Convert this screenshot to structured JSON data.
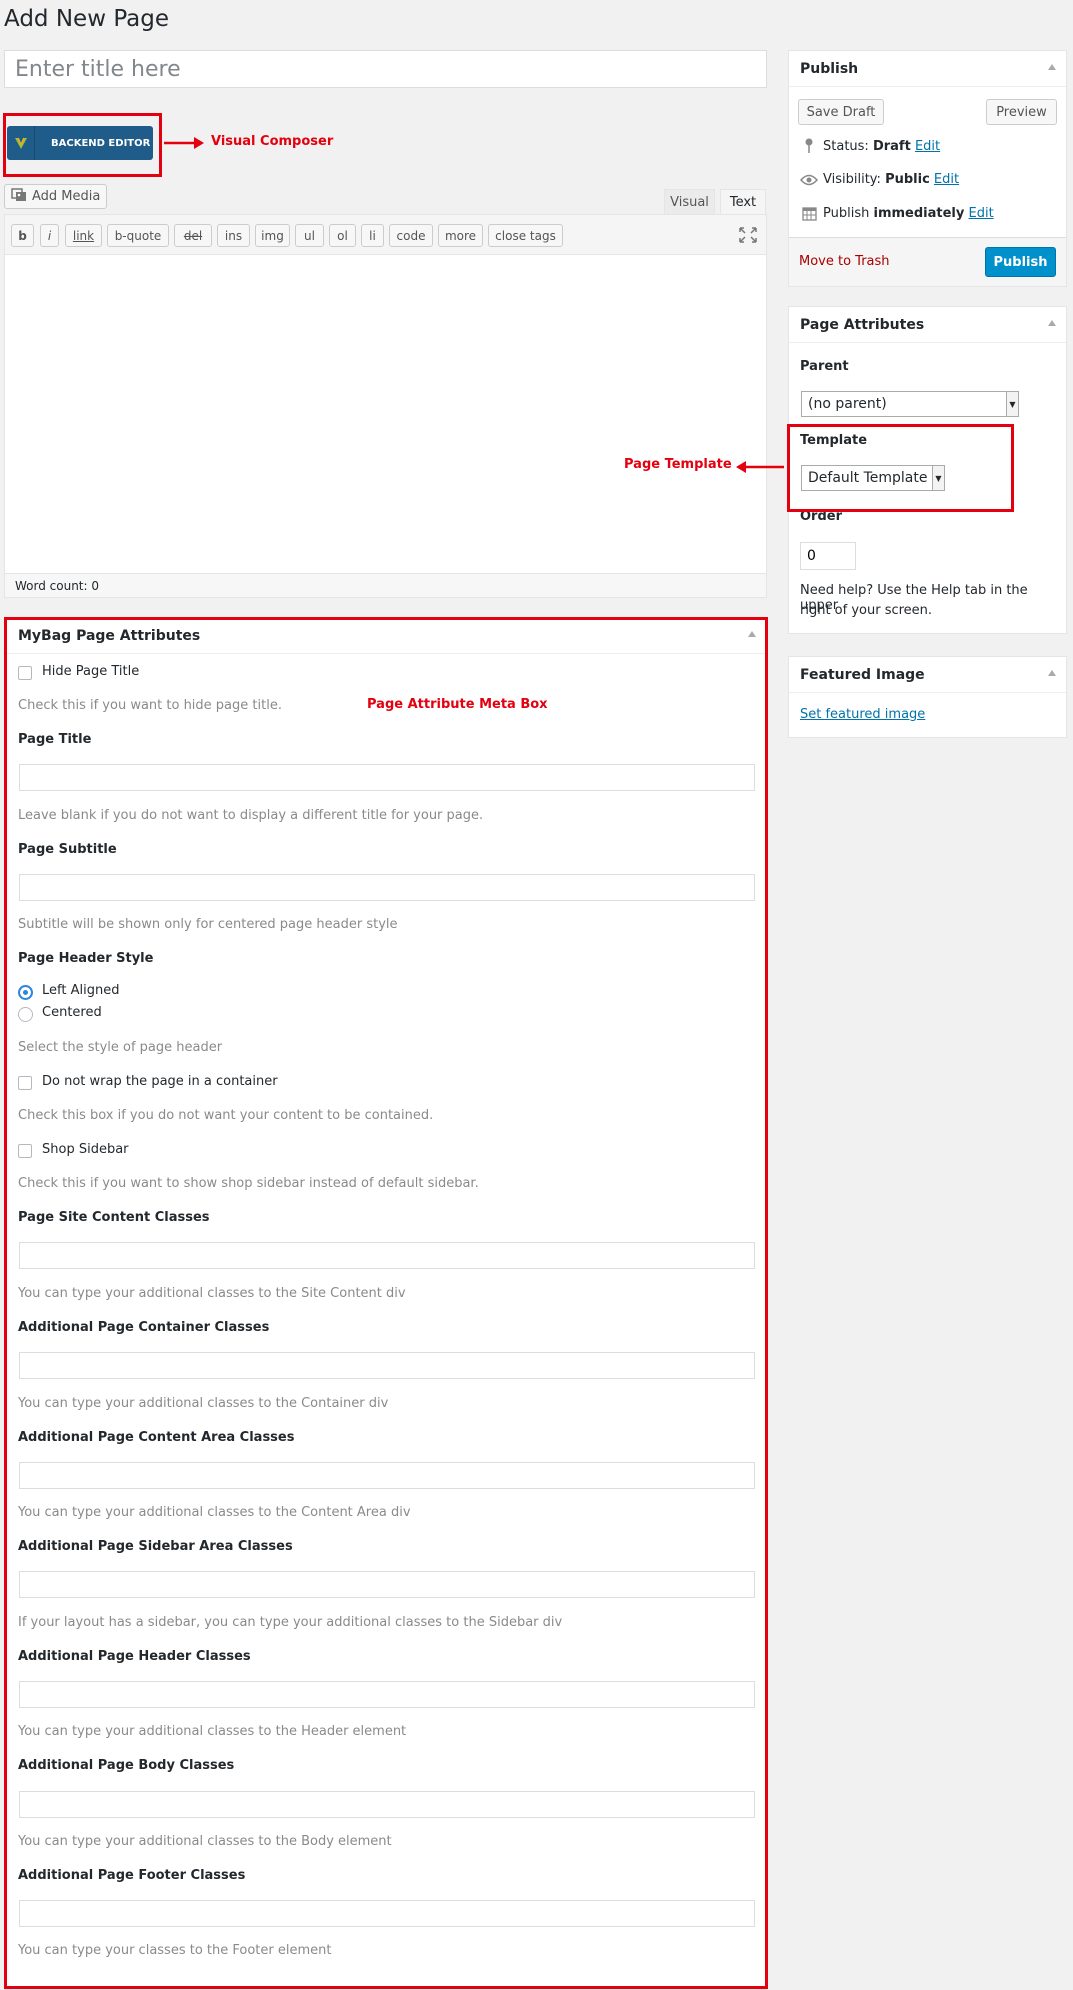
{
  "page": {
    "title": "Add New Page",
    "title_placeholder": "Enter title here"
  },
  "editor": {
    "backend_editor_label": "BACKEND EDITOR",
    "add_media_label": "Add Media",
    "tabs": {
      "visual": "Visual",
      "text": "Text"
    },
    "quicktags": [
      "b",
      "i",
      "link",
      "b-quote",
      "del",
      "ins",
      "img",
      "ul",
      "ol",
      "li",
      "code",
      "more",
      "close tags"
    ],
    "word_count": "Word count: 0"
  },
  "annotations": {
    "visual_composer": "Visual Composer",
    "page_template": "Page Template",
    "meta_box": "Page Attribute Meta Box",
    "color": "#e3000f"
  },
  "publish": {
    "heading": "Publish",
    "save_draft": "Save Draft",
    "preview": "Preview",
    "status_label": "Status:",
    "status_value": "Draft",
    "visibility_label": "Visibility:",
    "visibility_value": "Public",
    "publish_label": "Publish",
    "publish_value": "immediately",
    "edit": "Edit",
    "trash": "Move to Trash",
    "publish_button": "Publish"
  },
  "page_attributes": {
    "heading": "Page Attributes",
    "parent_label": "Parent",
    "parent_value": "(no parent)",
    "template_label": "Template",
    "template_value": "Default Template",
    "order_label": "Order",
    "order_value": "0",
    "help_line1": "Need help? Use the Help tab in the upper",
    "help_line2": "right of your screen."
  },
  "featured_image": {
    "heading": "Featured Image",
    "link": "Set featured image"
  },
  "mybag": {
    "heading": "MyBag Page Attributes",
    "hide_title_label": "Hide Page Title",
    "hide_title_desc": "Check this if you want to hide page title.",
    "page_title_label": "Page Title",
    "page_title_desc": "Leave blank if you do not want to display a different title for your page.",
    "page_subtitle_label": "Page Subtitle",
    "page_subtitle_desc": "Subtitle will be shown only for centered page header style",
    "header_style_label": "Page Header Style",
    "header_style_options": [
      "Left Aligned",
      "Centered"
    ],
    "header_style_selected": "Left Aligned",
    "header_style_desc": "Select the style of page header",
    "no_wrap_label": "Do not wrap the page in a container",
    "no_wrap_desc": "Check this box if you do not want your content to be contained.",
    "shop_sidebar_label": "Shop Sidebar",
    "shop_sidebar_desc": "Check this if you want to show shop sidebar instead of default sidebar.",
    "site_content_label": "Page Site Content Classes",
    "site_content_desc": "You can type your additional classes to the Site Content div",
    "container_label": "Additional Page Container Classes",
    "container_desc": "You can type your additional classes to the Container div",
    "content_area_label": "Additional Page Content Area Classes",
    "content_area_desc": "You can type your additional classes to the Content Area div",
    "sidebar_area_label": "Additional Page Sidebar Area Classes",
    "sidebar_area_desc": "If your layout has a sidebar, you can type your additional classes to the Sidebar div",
    "header_classes_label": "Additional Page Header Classes",
    "header_classes_desc": "You can type your additional classes to the Header element",
    "body_classes_label": "Additional Page Body Classes",
    "body_classes_desc": "You can type your additional classes to the Body element",
    "footer_classes_label": "Additional Page Footer Classes",
    "footer_classes_desc": "You can type your classes to the Footer element"
  }
}
